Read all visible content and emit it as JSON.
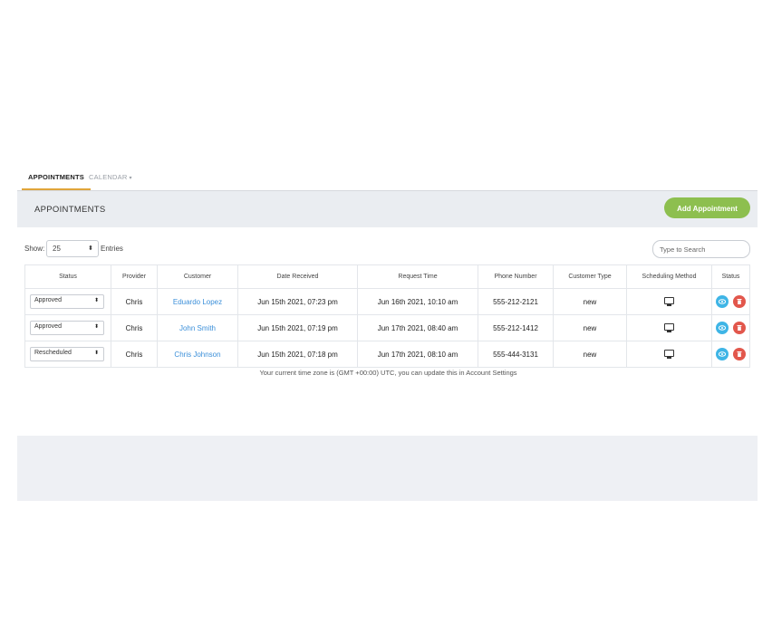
{
  "tabs": [
    {
      "label": "APPOINTMENTS"
    },
    {
      "label": "CALENDAR",
      "caret": "▾"
    }
  ],
  "panel": {
    "title": "APPOINTMENTS",
    "add_button": "Add Appointment"
  },
  "controls": {
    "show_label": "Show:",
    "show_value": "25",
    "entries_label": "Entries",
    "search_placeholder": "Type to Search"
  },
  "table": {
    "headers": [
      "Status",
      "Provider",
      "Customer",
      "Date Received",
      "Request Time",
      "Phone Number",
      "Customer Type",
      "Scheduling Method",
      "Status"
    ],
    "rows": [
      {
        "status": "Approved",
        "provider": "Chris",
        "customer": "Eduardo Lopez",
        "date_received": "Jun 15th 2021, 07:23 pm",
        "request_time": "Jun 16th 2021, 10:10 am",
        "phone": "555-212-2121",
        "customer_type": "new",
        "method_icon": "monitor-icon"
      },
      {
        "status": "Approved",
        "provider": "Chris",
        "customer": "John Smith",
        "date_received": "Jun 15th 2021, 07:19 pm",
        "request_time": "Jun 17th 2021, 08:40 am",
        "phone": "555-212-1412",
        "customer_type": "new",
        "method_icon": "monitor-icon"
      },
      {
        "status": "Rescheduled",
        "provider": "Chris",
        "customer": "Chris Johnson",
        "date_received": "Jun 15th 2021, 07:18 pm",
        "request_time": "Jun 17th 2021, 08:10 am",
        "phone": "555-444-3131",
        "customer_type": "new",
        "method_icon": "monitor-icon"
      }
    ]
  },
  "timezone_note": "Your current time zone is (GMT +00:00) UTC, you can update this in Account Settings",
  "colors": {
    "accent_tab": "#e0a53a",
    "add_button": "#8dbf4f",
    "link": "#3b8fd9",
    "view_button": "#3fb5e6",
    "delete_button": "#e2574c"
  }
}
